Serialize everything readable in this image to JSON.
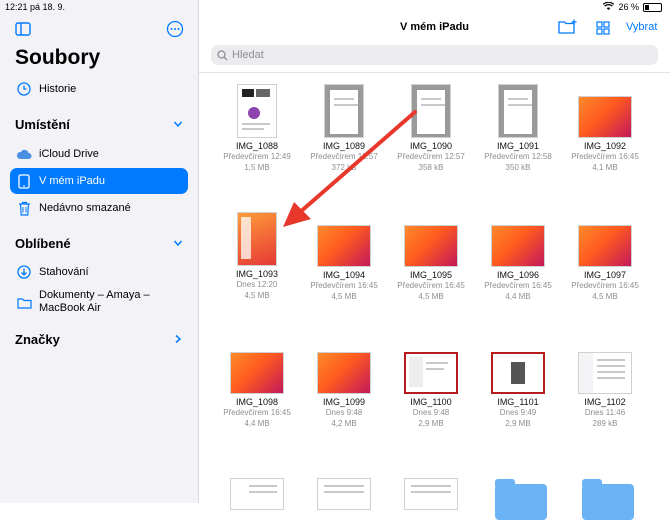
{
  "status": {
    "time": "12:21",
    "date": "pá 18. 9.",
    "battery_text": "26 %",
    "battery_level": 0.26
  },
  "sidebar": {
    "title": "Soubory",
    "history": "Historie",
    "locations_header": "Umístění",
    "locations": [
      {
        "label": "iCloud Drive",
        "icon": "cloud-icon"
      },
      {
        "label": "V mém iPadu",
        "icon": "ipad-icon",
        "selected": true
      },
      {
        "label": "Nedávno smazané",
        "icon": "trash-icon"
      }
    ],
    "favorites_header": "Oblíbené",
    "favorites": [
      {
        "label": "Stahování",
        "icon": "download-icon"
      },
      {
        "label_line1": "Dokumenty – Amaya –",
        "label_line2": "MacBook Air",
        "icon": "folder-icon"
      }
    ],
    "tags_header": "Značky"
  },
  "main": {
    "title": "V mém iPadu",
    "select_label": "Vybrat",
    "search_placeholder": "Hledat",
    "files": [
      {
        "name": "IMG_1088",
        "date": "Předevčírem 12:49",
        "size": "1,5 MB"
      },
      {
        "name": "IMG_1089",
        "date": "Předevčírem 12:57",
        "size": "372 kB"
      },
      {
        "name": "IMG_1090",
        "date": "Předevčírem 12:57",
        "size": "358 kB"
      },
      {
        "name": "IMG_1091",
        "date": "Předevčírem 12:58",
        "size": "350 kB"
      },
      {
        "name": "IMG_1092",
        "date": "Předevčírem 16:45",
        "size": "4,1 MB"
      },
      {
        "name": "IMG_1093",
        "date": "Dnes 12:20",
        "size": "4,5 MB"
      },
      {
        "name": "IMG_1094",
        "date": "Předevčírem 16:45",
        "size": "4,5 MB"
      },
      {
        "name": "IMG_1095",
        "date": "Předevčírem 16:45",
        "size": "4,5 MB"
      },
      {
        "name": "IMG_1096",
        "date": "Předevčírem 16:45",
        "size": "4,4 MB"
      },
      {
        "name": "IMG_1097",
        "date": "Předevčírem 16:45",
        "size": "4,5 MB"
      },
      {
        "name": "IMG_1098",
        "date": "Předevčírem 16:45",
        "size": "4,4 MB"
      },
      {
        "name": "IMG_1099",
        "date": "Dnes 9:48",
        "size": "4,2 MB"
      },
      {
        "name": "IMG_1100",
        "date": "Dnes 9:48",
        "size": "2,9 MB"
      },
      {
        "name": "IMG_1101",
        "date": "Dnes 9:49",
        "size": "2,9 MB"
      },
      {
        "name": "IMG_1102",
        "date": "Dnes 11:46",
        "size": "289 kB"
      }
    ]
  },
  "colors": {
    "accent": "#007aff",
    "arrow": "#e8372b",
    "sidebar_bg": "#f2f2f7"
  }
}
